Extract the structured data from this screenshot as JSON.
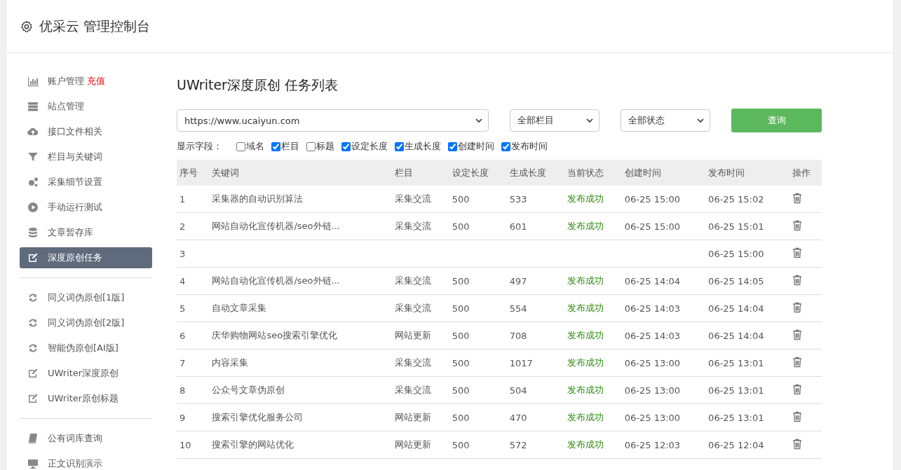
{
  "header": {
    "title": "优采云 管理控制台"
  },
  "sidebar": {
    "groups": [
      [
        {
          "label": "账户管理",
          "badge": "充值",
          "selected": false
        },
        {
          "label": "站点管理",
          "selected": false
        },
        {
          "label": "接口文件相关",
          "selected": false
        },
        {
          "label": "栏目与关键词",
          "selected": false
        },
        {
          "label": "采集细节设置",
          "selected": false
        },
        {
          "label": "手动运行测试",
          "selected": false
        },
        {
          "label": "文章暂存库",
          "selected": false
        },
        {
          "label": "深度原创任务",
          "selected": true
        }
      ],
      [
        {
          "label": "同义词伪原创[1版]",
          "selected": false
        },
        {
          "label": "同义词伪原创[2版]",
          "selected": false
        },
        {
          "label": "智能伪原创[AI版]",
          "selected": false
        },
        {
          "label": "UWriter深度原创",
          "selected": false
        },
        {
          "label": "UWriter原创标题",
          "selected": false
        }
      ],
      [
        {
          "label": "公有词库查询",
          "selected": false
        },
        {
          "label": "正文识别演示",
          "selected": false
        }
      ]
    ]
  },
  "page_title": "UWriter深度原创 任务列表",
  "filters": {
    "site": "https://www.ucaiyun.com",
    "column": "全部栏目",
    "status": "全部状态",
    "button": "查询"
  },
  "fields": {
    "label": "显示字段：",
    "options": [
      {
        "label": "域名",
        "checked": false
      },
      {
        "label": "栏目",
        "checked": true
      },
      {
        "label": "标题",
        "checked": false
      },
      {
        "label": "设定长度",
        "checked": true
      },
      {
        "label": "生成长度",
        "checked": true
      },
      {
        "label": "创建时间",
        "checked": true
      },
      {
        "label": "发布时间",
        "checked": true
      }
    ]
  },
  "table": {
    "columns": [
      "序号",
      "关键词",
      "栏目",
      "设定长度",
      "生成长度",
      "当前状态",
      "创建时间",
      "发布时间",
      "操作"
    ],
    "rows": [
      {
        "no": "1",
        "keyword": "采集器的自动识别算法",
        "column": "采集交流",
        "set_length": "500",
        "gen_length": "533",
        "status": "发布成功",
        "created": "06-25 15:00",
        "published": "06-25 15:02"
      },
      {
        "no": "2",
        "keyword": "网站自动化宣传机器/seo外链...",
        "column": "采集交流",
        "set_length": "500",
        "gen_length": "601",
        "status": "发布成功",
        "created": "06-25 15:00",
        "published": "06-25 15:01"
      },
      {
        "no": "3",
        "published": "06-25 15:00"
      },
      {
        "no": "4",
        "keyword": "网站自动化宣传机器/seo外链...",
        "column": "采集交流",
        "set_length": "500",
        "gen_length": "497",
        "status": "发布成功",
        "created": "06-25 14:04",
        "published": "06-25 14:05"
      },
      {
        "no": "5",
        "keyword": "自动文章采集",
        "column": "采集交流",
        "set_length": "500",
        "gen_length": "554",
        "status": "发布成功",
        "created": "06-25 14:03",
        "published": "06-25 14:04"
      },
      {
        "no": "6",
        "keyword": "庆华购物网站seo搜索引擎优化",
        "column": "网站更新",
        "set_length": "500",
        "gen_length": "708",
        "status": "发布成功",
        "created": "06-25 14:03",
        "published": "06-25 14:04"
      },
      {
        "no": "7",
        "keyword": "内容采集",
        "column": "采集交流",
        "set_length": "500",
        "gen_length": "1017",
        "status": "发布成功",
        "created": "06-25 13:00",
        "published": "06-25 13:01"
      },
      {
        "no": "8",
        "keyword": "公众号文章伪原创",
        "column": "采集交流",
        "set_length": "500",
        "gen_length": "504",
        "status": "发布成功",
        "created": "06-25 13:00",
        "published": "06-25 13:01"
      },
      {
        "no": "9",
        "keyword": "搜索引擎优化服务公司",
        "column": "网站更新",
        "set_length": "500",
        "gen_length": "470",
        "status": "发布成功",
        "created": "06-25 13:00",
        "published": "06-25 13:01"
      },
      {
        "no": "10",
        "keyword": "搜索引擎的网站优化",
        "column": "网站更新",
        "set_length": "500",
        "gen_length": "572",
        "status": "发布成功",
        "created": "06-25 12:03",
        "published": "06-25 12:04"
      }
    ]
  }
}
